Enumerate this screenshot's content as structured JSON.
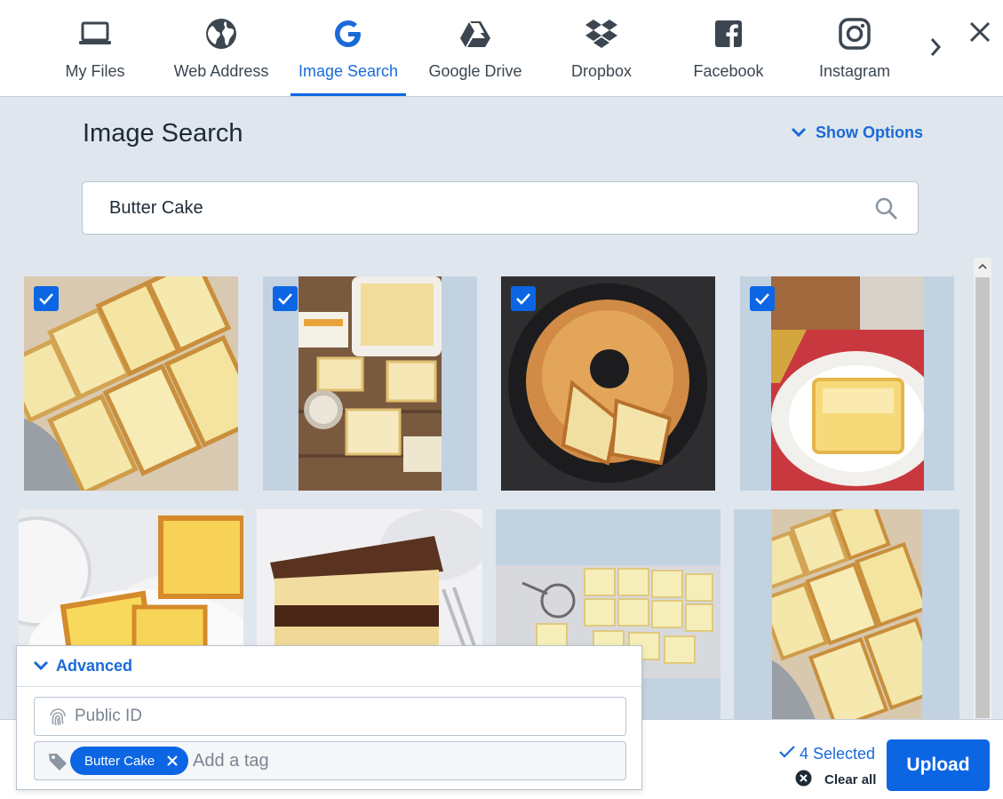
{
  "nav": {
    "tabs": [
      {
        "label": "My Files",
        "icon": "laptop-icon"
      },
      {
        "label": "Web Address",
        "icon": "globe-icon"
      },
      {
        "label": "Image Search",
        "icon": "google-icon",
        "active": true
      },
      {
        "label": "Google Drive",
        "icon": "google-drive-icon"
      },
      {
        "label": "Dropbox",
        "icon": "dropbox-icon"
      },
      {
        "label": "Facebook",
        "icon": "facebook-icon"
      },
      {
        "label": "Instagram",
        "icon": "instagram-icon"
      }
    ],
    "next_icon": "chevron-right-icon",
    "close_icon": "close-icon"
  },
  "page": {
    "title": "Image Search",
    "show_options_label": "Show Options"
  },
  "search": {
    "value": "Butter Cake",
    "icon": "search-icon"
  },
  "results": [
    {
      "selected": true,
      "subject": "sliced butter cake pieces"
    },
    {
      "selected": true,
      "subject": "butter cake squares on wooden board"
    },
    {
      "selected": true,
      "subject": "bundt butter cake on black plate"
    },
    {
      "selected": true,
      "subject": "gooey butter cake square on plate"
    },
    {
      "selected": false,
      "subject": "butter cake slices with tea"
    },
    {
      "selected": false,
      "subject": "chocolate frosted layer butter cake"
    },
    {
      "selected": false,
      "subject": "lemon butter cake bars"
    },
    {
      "selected": false,
      "subject": "butter cake slices close up"
    }
  ],
  "advanced": {
    "label": "Advanced",
    "public_id_placeholder": "Public ID",
    "tag_placeholder": "Add a tag",
    "tags": [
      "Butter Cake"
    ]
  },
  "footer": {
    "selected_label": "4 Selected",
    "clear_all_label": "Clear all",
    "upload_label": "Upload"
  },
  "colors": {
    "accent": "#0c66e4",
    "accent_text": "#1a6ad8",
    "background": "#dfe6ee",
    "tile_placeholder": "#c3d2e0"
  }
}
